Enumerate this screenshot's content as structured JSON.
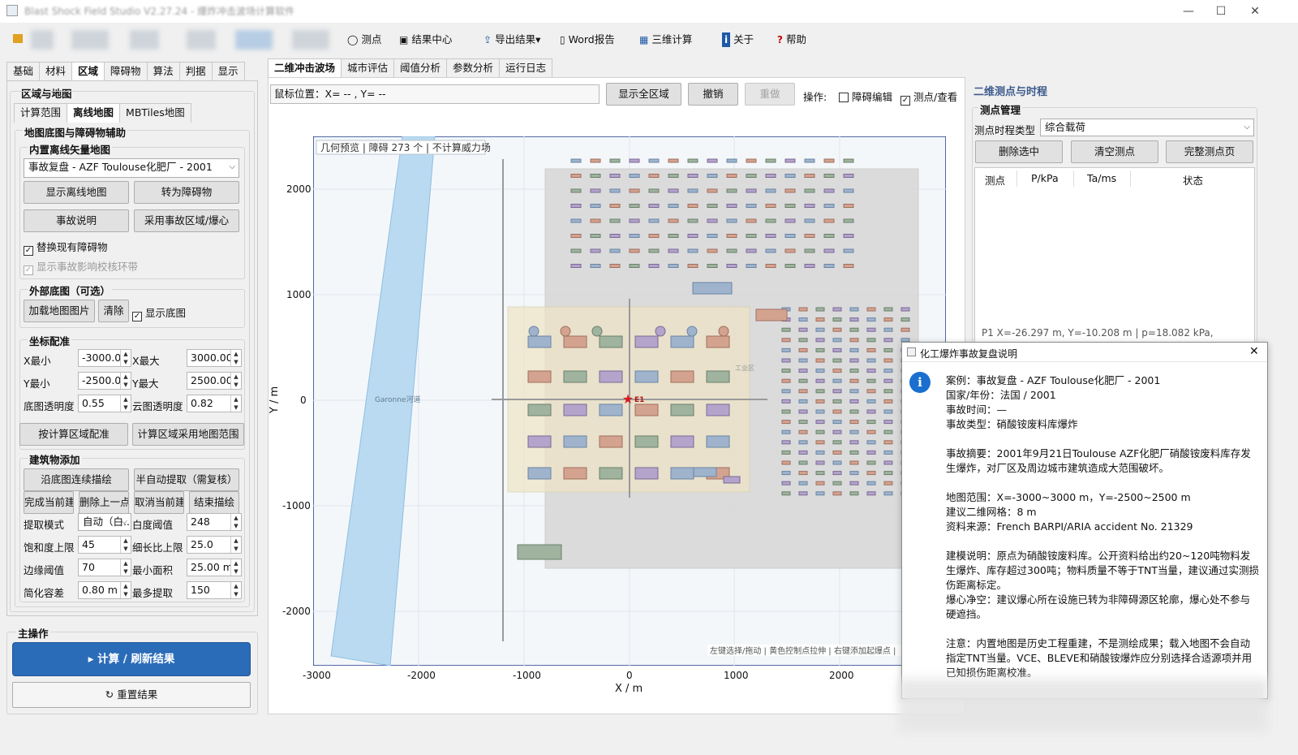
{
  "window": {
    "title": "Blast Shock Field Studio V2.27.24 - 爆炸冲击波场计算软件"
  },
  "toolbar": {
    "measure": "测点",
    "results_center": "结果中心",
    "export": "导出结果▾",
    "word_report": "Word报告",
    "3d_calc": "三维计算",
    "about": "关于",
    "help": "帮助"
  },
  "left_tabs": [
    "基础",
    "材料",
    "区域",
    "障碍物",
    "算法",
    "判据",
    "显示"
  ],
  "section_title": "区域与地图",
  "sub_tabs": [
    "计算范围",
    "离线地图",
    "MBTiles地图"
  ],
  "map_assist": {
    "title": "地图底图与障碍物辅助",
    "builtin": {
      "title": "内置离线矢量地图",
      "selected": "事故复盘 - AZF Toulouse化肥厂 - 2001",
      "show_map": "显示离线地图",
      "to_obstacle": "转为障碍物",
      "incident_desc": "事故说明",
      "use_region": "采用事故区域/爆心",
      "replace_label": "替换现有障碍物",
      "show_ring_label": "显示事故影响校核环带"
    },
    "external": {
      "title": "外部底图（可选）",
      "load": "加载地图图片",
      "clear": "清除",
      "show_base": "显示底图"
    },
    "coords": {
      "title": "坐标配准",
      "xmin_label": "X最小",
      "xmin": "-3000.00",
      "xmax_label": "X最大",
      "xmax": "3000.00",
      "ymin_label": "Y最小",
      "ymin": "-2500.00",
      "ymax_label": "Y最大",
      "ymax": "2500.00",
      "base_opacity_label": "底图透明度",
      "base_opacity": "0.55",
      "cloud_opacity_label": "云图透明度",
      "cloud_opacity": "0.82",
      "by_region": "按计算区域配准",
      "use_map_range": "计算区域采用地图范围"
    },
    "buildings": {
      "title": "建筑物添加",
      "trace": "沿底图连续描绘",
      "auto_extract": "半自动提取（需复核）",
      "finish_current": "完成当前建",
      "delete_prev": "删除上一点",
      "cancel_current": "取消当前建",
      "end_trace": "结束描绘",
      "mode_label": "提取模式",
      "mode": "自动（白...",
      "white_th_label": "白度阈值",
      "white_th": "248",
      "sat_label": "饱和度上限",
      "sat": "45",
      "ratio_label": "细长比上限",
      "ratio": "25.0",
      "edge_label": "边缘阈值",
      "edge": "70",
      "min_area_label": "最小面积",
      "min_area": "25.00 m²",
      "simplify_label": "简化容差",
      "simplify": "0.80 m",
      "max_extract_label": "最多提取",
      "max_extract": "150"
    }
  },
  "main_ops": {
    "title": "主操作",
    "compute": "▸ 计算 / 刷新结果",
    "reset": "重置结果"
  },
  "center_tabs": [
    "二维冲击波场",
    "城市评估",
    "阈值分析",
    "参数分析",
    "运行日志"
  ],
  "center_bar": {
    "mouse_pos": "鼠标位置：X= -- , Y= --",
    "show_all": "显示全区域",
    "undo": "撤销",
    "redo": "重做",
    "ops_label": "操作:",
    "obstacle_edit": "障碍编辑",
    "measure_view": "测点/查看"
  },
  "plot": {
    "badge": "几何预览 | 障碍 273 个 | 不计算威力场",
    "river_label": "Garonne河道",
    "charge_label": "E1",
    "zone_label": "工业区",
    "hint": "左键选择/拖动 | 黄色控制点拉伸 | 右键添加起爆点 |",
    "xlabel": "X / m",
    "ylabel": "Y / m",
    "xticks": [
      "-3000",
      "-2000",
      "-1000",
      "0",
      "1000",
      "2000"
    ],
    "yticks": [
      "2000",
      "1000",
      "0",
      "-1000",
      "-2000"
    ]
  },
  "right": {
    "title": "二维测点与时程",
    "mgmt": "测点管理",
    "type_label": "测点时程类型",
    "type_value": "综合载荷",
    "delete_sel": "删除选中",
    "clear": "清空测点",
    "full_page": "完整测点页",
    "cols": [
      "测点",
      "P/kPa",
      "Ta/ms",
      "状态"
    ],
    "status_line": "P1  X=-26.297 m, Y=-10.208 m  |  p=18.082 kPa,"
  },
  "dialog": {
    "title": "化工爆炸事故复盘说明",
    "lines": [
      "案例：事故复盘 - AZF Toulouse化肥厂 - 2001",
      "国家/年份：法国 / 2001",
      "事故时间：—",
      "事故类型：硝酸铵废料库爆炸",
      "",
      "事故摘要：2001年9月21日Toulouse AZF化肥厂硝酸铵废料库存发生爆炸，对厂区及周边城市建筑造成大范围破坏。",
      "",
      "地图范围：X=-3000~3000 m，Y=-2500~2500 m",
      "建议二维网格：8 m",
      "资料来源：French BARPI/ARIA accident No. 21329",
      "",
      "建模说明：原点为硝酸铵废料库。公开资料给出约20~120吨物料发生爆炸、库存超过300吨；物料质量不等于TNT当量，建议通过实测损伤距离标定。",
      "爆心净空：建议爆心所在设施已转为非障碍源区轮廓，爆心处不参与硬遮挡。",
      "",
      "注意：内置地图是历史工程重建，不是测绘成果；载入地图不会自动指定TNT当量。VCE、BLEVE和硝酸铵爆炸应分别选择合适源项并用已知损伤距离校准。"
    ]
  },
  "colors": {
    "primary": "#2b6cb8",
    "river": "#b9daf0",
    "zone_yellow": "#efe4c4",
    "zone_gray": "#d7d7d7",
    "charge": "#d81b1b"
  }
}
